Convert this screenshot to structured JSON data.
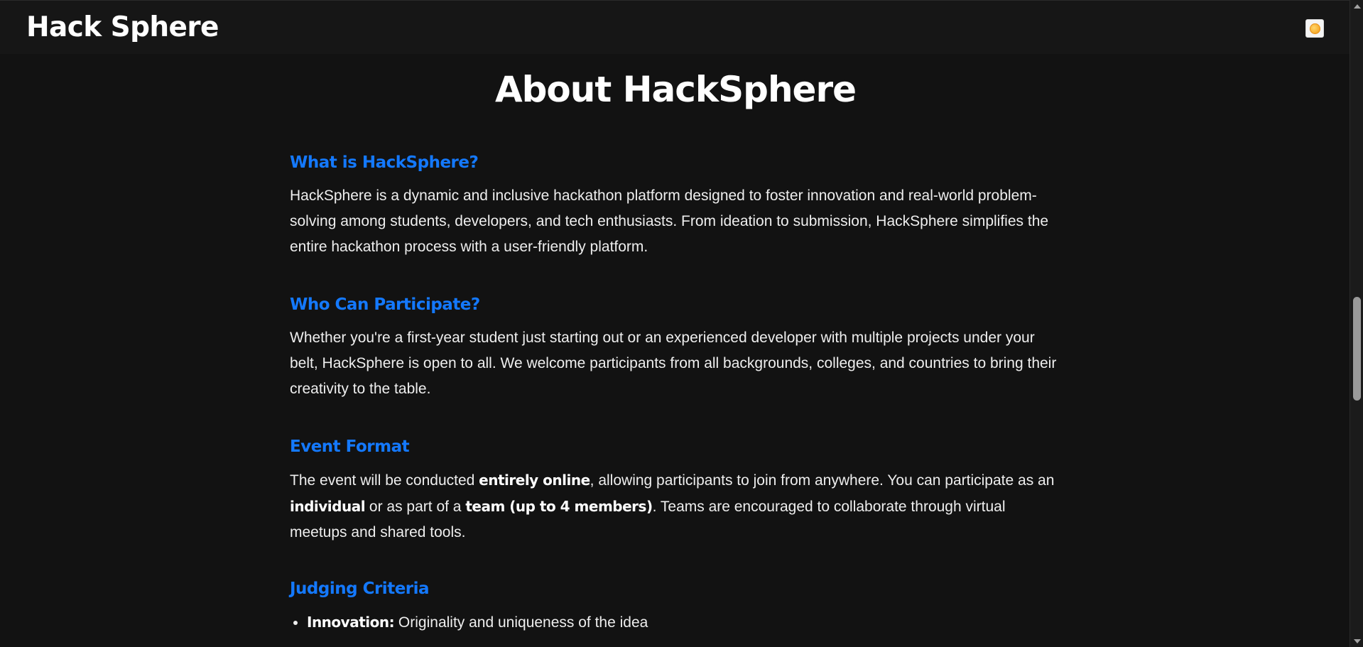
{
  "header": {
    "brand": "Hack Sphere",
    "theme_toggle_icon": "sun-icon"
  },
  "main": {
    "title": "About HackSphere",
    "sections": [
      {
        "heading": "What is HackSphere?",
        "body": "HackSphere is a dynamic and inclusive hackathon platform designed to foster innovation and real-world problem-solving among students, developers, and tech enthusiasts. From ideation to submission, HackSphere simplifies the entire hackathon process with a user-friendly platform."
      },
      {
        "heading": "Who Can Participate?",
        "body": "Whether you're a first-year student just starting out or an experienced developer with multiple projects under your belt, HackSphere is open to all. We welcome participants from all backgrounds, colleges, and countries to bring their creativity to the table."
      },
      {
        "heading": "Event Format",
        "body_parts": [
          "The event will be conducted ",
          "entirely online",
          ", allowing participants to join from anywhere. You can participate as an ",
          "individual",
          " or as part of a ",
          "team (up to 4 members)",
          ". Teams are encouraged to collaborate through virtual meetups and shared tools."
        ]
      },
      {
        "heading": "Judging Criteria",
        "items": [
          {
            "label": "Innovation:",
            "text": " Originality and uniqueness of the idea"
          }
        ]
      }
    ]
  },
  "colors": {
    "background": "#121212",
    "header_background": "#161616",
    "accent": "#1479ff",
    "text": "#eeeeee"
  }
}
